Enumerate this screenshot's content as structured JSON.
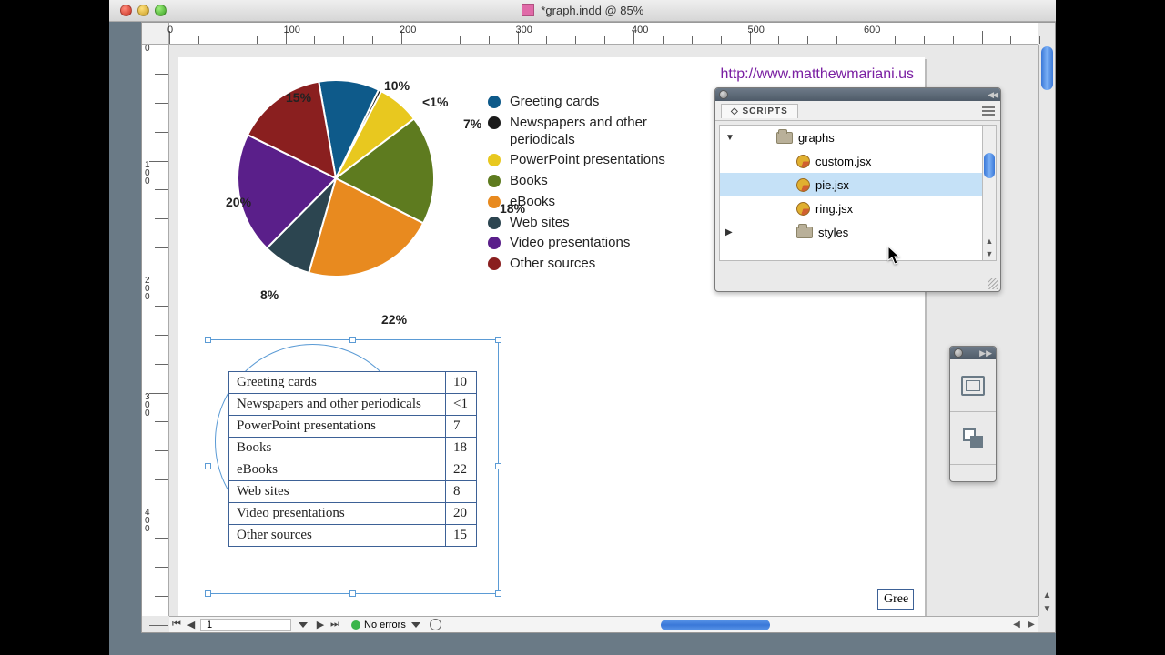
{
  "window": {
    "title": "*graph.indd @ 85%"
  },
  "ruler_h_labels": [
    "0",
    "100",
    "200",
    "300",
    "400",
    "500",
    "600"
  ],
  "ruler_v_labels": [
    "0",
    "100",
    "200",
    "300",
    "400"
  ],
  "url": "http://www.matthewmariani.us",
  "chart_data": {
    "type": "pie",
    "title": "",
    "slices": [
      {
        "label": "Greeting cards",
        "value": 10,
        "pct": "10%",
        "color": "#0e5a8a"
      },
      {
        "label": "Newspapers and other periodicals",
        "value": 0.5,
        "pct": "<1%",
        "color": "#1a1a1a"
      },
      {
        "label": "PowerPoint presentations",
        "value": 7,
        "pct": "7%",
        "color": "#e8c81f"
      },
      {
        "label": "Books",
        "value": 18,
        "pct": "18%",
        "color": "#5e7b1f"
      },
      {
        "label": "eBooks",
        "value": 22,
        "pct": "22%",
        "color": "#e88a1f"
      },
      {
        "label": "Web sites",
        "value": 8,
        "pct": "8%",
        "color": "#2c4550"
      },
      {
        "label": "Video presentations",
        "value": 20,
        "pct": "20%",
        "color": "#5a1f8a"
      },
      {
        "label": "Other sources",
        "value": 15,
        "pct": "15%",
        "color": "#8a1f1f"
      }
    ]
  },
  "table": {
    "rows": [
      {
        "label": "Greeting cards",
        "value": "10"
      },
      {
        "label": "Newspapers and other periodicals",
        "value": "<1"
      },
      {
        "label": "PowerPoint presentations",
        "value": "7"
      },
      {
        "label": "Books",
        "value": "18"
      },
      {
        "label": "eBooks",
        "value": "22"
      },
      {
        "label": "Web sites",
        "value": "8"
      },
      {
        "label": "Video presentations",
        "value": "20"
      },
      {
        "label": "Other sources",
        "value": "15"
      }
    ]
  },
  "scripts_panel": {
    "title": "SCRIPTS",
    "items": [
      {
        "type": "folder",
        "name": "graphs",
        "expanded": true,
        "level": 1
      },
      {
        "type": "script",
        "name": "custom.jsx",
        "level": 2
      },
      {
        "type": "script",
        "name": "pie.jsx",
        "level": 2,
        "selected": true
      },
      {
        "type": "script",
        "name": "ring.jsx",
        "level": 2
      },
      {
        "type": "folder",
        "name": "styles",
        "expanded": false,
        "level": 2
      }
    ]
  },
  "statusbar": {
    "page": "1",
    "errors": "No errors"
  },
  "clipped_box": "Gree"
}
